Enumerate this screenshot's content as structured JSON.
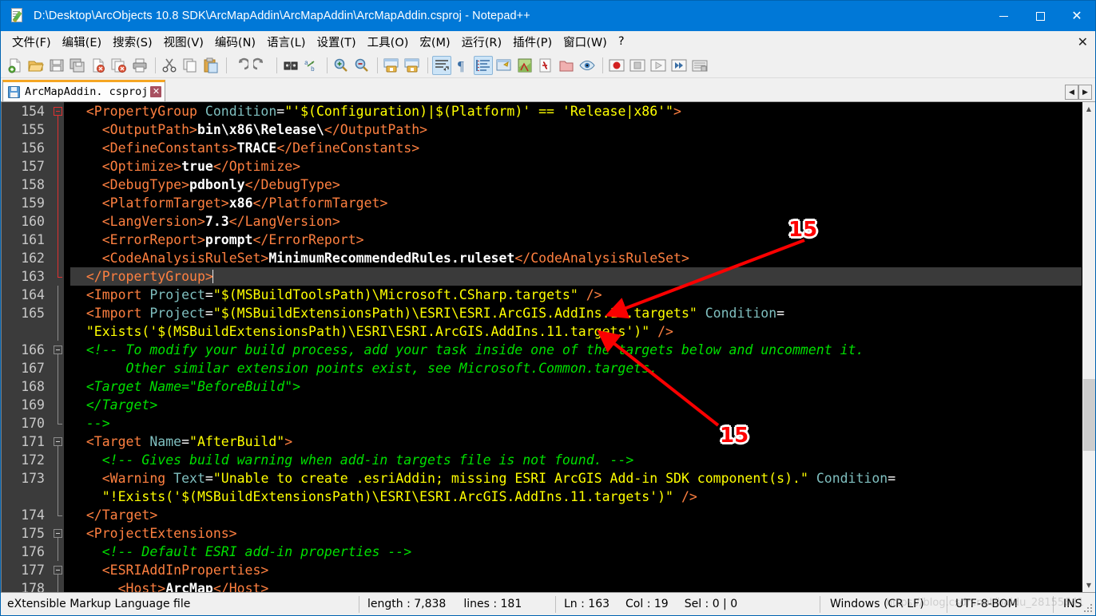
{
  "window": {
    "title": "D:\\Desktop\\ArcObjects 10.8 SDK\\ArcMapAddin\\ArcMapAddin\\ArcMapAddin.csproj - Notepad++",
    "app_icon": "notepad-plus-plus-icon",
    "minimize_label": "–",
    "maximize_label": "",
    "close_label": "✕",
    "titlebar_color": "#0078d7"
  },
  "menu": {
    "items": [
      {
        "label": "文件(F)",
        "name": "menu-file"
      },
      {
        "label": "编辑(E)",
        "name": "menu-edit"
      },
      {
        "label": "搜索(S)",
        "name": "menu-search"
      },
      {
        "label": "视图(V)",
        "name": "menu-view"
      },
      {
        "label": "编码(N)",
        "name": "menu-encoding"
      },
      {
        "label": "语言(L)",
        "name": "menu-language"
      },
      {
        "label": "设置(T)",
        "name": "menu-settings"
      },
      {
        "label": "工具(O)",
        "name": "menu-tools"
      },
      {
        "label": "宏(M)",
        "name": "menu-macro"
      },
      {
        "label": "运行(R)",
        "name": "menu-run"
      },
      {
        "label": "插件(P)",
        "name": "menu-plugins"
      },
      {
        "label": "窗口(W)",
        "name": "menu-window"
      },
      {
        "label": "?",
        "name": "menu-help"
      }
    ],
    "close_doc_label": "✕"
  },
  "toolbar": {
    "buttons": [
      {
        "name": "new-file-icon",
        "title": "New"
      },
      {
        "name": "open-file-icon",
        "title": "Open"
      },
      {
        "name": "save-icon",
        "title": "Save"
      },
      {
        "name": "save-all-icon",
        "title": "Save All"
      },
      {
        "name": "close-file-icon",
        "title": "Close"
      },
      {
        "name": "close-all-icon",
        "title": "Close All"
      },
      {
        "name": "print-icon",
        "title": "Print"
      },
      {
        "name": "sep",
        "title": ""
      },
      {
        "name": "cut-icon",
        "title": "Cut"
      },
      {
        "name": "copy-icon",
        "title": "Copy"
      },
      {
        "name": "paste-icon",
        "title": "Paste"
      },
      {
        "name": "sep",
        "title": ""
      },
      {
        "name": "undo-icon",
        "title": "Undo"
      },
      {
        "name": "redo-icon",
        "title": "Redo"
      },
      {
        "name": "sep",
        "title": ""
      },
      {
        "name": "find-icon",
        "title": "Find"
      },
      {
        "name": "replace-icon",
        "title": "Replace"
      },
      {
        "name": "sep",
        "title": ""
      },
      {
        "name": "zoom-in-icon",
        "title": "Zoom In"
      },
      {
        "name": "zoom-out-icon",
        "title": "Zoom Out"
      },
      {
        "name": "sep",
        "title": ""
      },
      {
        "name": "sync-vertical-icon",
        "title": "Sync Vertical Scrolling"
      },
      {
        "name": "sync-horizontal-icon",
        "title": "Sync Horizontal Scrolling"
      },
      {
        "name": "sep",
        "title": ""
      },
      {
        "name": "word-wrap-icon",
        "title": "Word wrap"
      },
      {
        "name": "show-all-chars-icon",
        "title": "Show All Characters"
      },
      {
        "name": "indent-guide-icon",
        "title": "Show Indent Guide"
      },
      {
        "name": "user-defined-dialog-icon",
        "title": "User Defined Dialogue"
      },
      {
        "name": "doc-map-icon",
        "title": "Document Map"
      },
      {
        "name": "function-list-icon",
        "title": "Function List"
      },
      {
        "name": "folder-workspace-icon",
        "title": "Folder as Workspace"
      },
      {
        "name": "monitoring-icon",
        "title": "Monitoring"
      },
      {
        "name": "sep",
        "title": ""
      },
      {
        "name": "macro-record-icon",
        "title": "Start Recording"
      },
      {
        "name": "macro-stop-icon",
        "title": "Stop Recording"
      },
      {
        "name": "macro-play-icon",
        "title": "Playback"
      },
      {
        "name": "macro-run-multi-icon",
        "title": "Run a Macro Multiple Times"
      },
      {
        "name": "macro-save-icon",
        "title": "Save Current Recorded Macro"
      }
    ]
  },
  "tabs": {
    "active_index": 0,
    "items": [
      {
        "label": "ArcMapAddin. csproj",
        "icon": "saved-disk-icon",
        "close_label": "✕"
      }
    ],
    "scroll_left_label": "◀",
    "scroll_right_label": "▶"
  },
  "editor": {
    "first_line": 154,
    "current_line": 163,
    "lines": [
      {
        "num": "154",
        "fold": "open-active",
        "tokens": [
          {
            "t": "  ",
            "c": "t-gray"
          },
          {
            "t": "<PropertyGroup",
            "c": "t-tag"
          },
          {
            "t": " Condition",
            "c": "t-attr"
          },
          {
            "t": "=",
            "c": "t-eq"
          },
          {
            "t": "\"'$(Configuration)|$(Platform)' == 'Release|x86'\"",
            "c": "t-str"
          },
          {
            "t": ">",
            "c": "t-tag"
          }
        ]
      },
      {
        "num": "155",
        "fold": "bar-active",
        "tokens": [
          {
            "t": "    ",
            "c": "t-gray"
          },
          {
            "t": "<OutputPath>",
            "c": "t-tag"
          },
          {
            "t": "bin\\x86\\Release\\",
            "c": "t-val"
          },
          {
            "t": "</OutputPath>",
            "c": "t-tag"
          }
        ]
      },
      {
        "num": "156",
        "fold": "bar-active",
        "tokens": [
          {
            "t": "    ",
            "c": "t-gray"
          },
          {
            "t": "<DefineConstants>",
            "c": "t-tag"
          },
          {
            "t": "TRACE",
            "c": "t-val"
          },
          {
            "t": "</DefineConstants>",
            "c": "t-tag"
          }
        ]
      },
      {
        "num": "157",
        "fold": "bar-active",
        "tokens": [
          {
            "t": "    ",
            "c": "t-gray"
          },
          {
            "t": "<Optimize>",
            "c": "t-tag"
          },
          {
            "t": "true",
            "c": "t-val"
          },
          {
            "t": "</Optimize>",
            "c": "t-tag"
          }
        ]
      },
      {
        "num": "158",
        "fold": "bar-active",
        "tokens": [
          {
            "t": "    ",
            "c": "t-gray"
          },
          {
            "t": "<DebugType>",
            "c": "t-tag"
          },
          {
            "t": "pdbonly",
            "c": "t-val"
          },
          {
            "t": "</DebugType>",
            "c": "t-tag"
          }
        ]
      },
      {
        "num": "159",
        "fold": "bar-active",
        "tokens": [
          {
            "t": "    ",
            "c": "t-gray"
          },
          {
            "t": "<PlatformTarget>",
            "c": "t-tag"
          },
          {
            "t": "x86",
            "c": "t-val"
          },
          {
            "t": "</PlatformTarget>",
            "c": "t-tag"
          }
        ]
      },
      {
        "num": "160",
        "fold": "bar-active",
        "tokens": [
          {
            "t": "    ",
            "c": "t-gray"
          },
          {
            "t": "<LangVersion>",
            "c": "t-tag"
          },
          {
            "t": "7.3",
            "c": "t-val"
          },
          {
            "t": "</LangVersion>",
            "c": "t-tag"
          }
        ]
      },
      {
        "num": "161",
        "fold": "bar-active",
        "tokens": [
          {
            "t": "    ",
            "c": "t-gray"
          },
          {
            "t": "<ErrorReport>",
            "c": "t-tag"
          },
          {
            "t": "prompt",
            "c": "t-val"
          },
          {
            "t": "</ErrorReport>",
            "c": "t-tag"
          }
        ]
      },
      {
        "num": "162",
        "fold": "bar-active",
        "tokens": [
          {
            "t": "    ",
            "c": "t-gray"
          },
          {
            "t": "<CodeAnalysisRuleSet>",
            "c": "t-tag"
          },
          {
            "t": "MinimumRecommendedRules.ruleset",
            "c": "t-val"
          },
          {
            "t": "</CodeAnalysisRuleSet>",
            "c": "t-tag"
          }
        ]
      },
      {
        "num": "163",
        "fold": "end-active",
        "current": true,
        "tokens": [
          {
            "t": "  ",
            "c": "t-gray"
          },
          {
            "t": "</PropertyGroup>",
            "c": "t-tag"
          },
          {
            "t": "\u0000caret",
            "c": "caret"
          }
        ]
      },
      {
        "num": "164",
        "fold": "bar",
        "tokens": [
          {
            "t": "  ",
            "c": "t-gray"
          },
          {
            "t": "<Import",
            "c": "t-tag"
          },
          {
            "t": " Project",
            "c": "t-attr"
          },
          {
            "t": "=",
            "c": "t-eq"
          },
          {
            "t": "\"$(MSBuildToolsPath)\\Microsoft.CSharp.targets\"",
            "c": "t-str"
          },
          {
            "t": " ",
            "c": "t-gray"
          },
          {
            "t": "/>",
            "c": "t-tag"
          }
        ]
      },
      {
        "num": "165",
        "fold": "bar",
        "tokens": [
          {
            "t": "  ",
            "c": "t-gray"
          },
          {
            "t": "<Import",
            "c": "t-tag"
          },
          {
            "t": " Project",
            "c": "t-attr"
          },
          {
            "t": "=",
            "c": "t-eq"
          },
          {
            "t": "\"$(MSBuildExtensionsPath)\\ESRI\\ESRI.ArcGIS.AddIns.11.targets\"",
            "c": "t-str"
          },
          {
            "t": " Condition",
            "c": "t-attr"
          },
          {
            "t": "=",
            "c": "t-eq"
          }
        ]
      },
      {
        "num": "",
        "fold": "bar",
        "wrap": true,
        "tokens": [
          {
            "t": "  ",
            "c": "t-gray"
          },
          {
            "t": "\"Exists('$(MSBuildExtensionsPath)\\ESRI\\ESRI.ArcGIS.AddIns.11.targets')\"",
            "c": "t-str"
          },
          {
            "t": " ",
            "c": "t-gray"
          },
          {
            "t": "/>",
            "c": "t-tag"
          }
        ]
      },
      {
        "num": "166",
        "fold": "open",
        "tokens": [
          {
            "t": "  ",
            "c": "t-gray"
          },
          {
            "t": "<!-- To modify your build process, add your task inside one of the targets below and uncomment it.",
            "c": "t-com"
          }
        ]
      },
      {
        "num": "167",
        "fold": "dotted",
        "tokens": [
          {
            "t": "       Other similar extension points exist, see Microsoft.Common.targets.",
            "c": "t-com"
          }
        ]
      },
      {
        "num": "168",
        "fold": "dotted",
        "tokens": [
          {
            "t": "  ",
            "c": "t-gray"
          },
          {
            "t": "<Target Name=\"BeforeBuild\">",
            "c": "t-com"
          }
        ]
      },
      {
        "num": "169",
        "fold": "dotted",
        "tokens": [
          {
            "t": "  ",
            "c": "t-gray"
          },
          {
            "t": "</Target>",
            "c": "t-com"
          }
        ]
      },
      {
        "num": "170",
        "fold": "end",
        "tokens": [
          {
            "t": "  ",
            "c": "t-gray"
          },
          {
            "t": "-->",
            "c": "t-com"
          }
        ]
      },
      {
        "num": "171",
        "fold": "open",
        "tokens": [
          {
            "t": "  ",
            "c": "t-gray"
          },
          {
            "t": "<Target",
            "c": "t-tag"
          },
          {
            "t": " Name",
            "c": "t-attr"
          },
          {
            "t": "=",
            "c": "t-eq"
          },
          {
            "t": "\"AfterBuild\"",
            "c": "t-str"
          },
          {
            "t": ">",
            "c": "t-tag"
          }
        ]
      },
      {
        "num": "172",
        "fold": "bar",
        "tokens": [
          {
            "t": "    ",
            "c": "t-gray"
          },
          {
            "t": "<!-- Gives build warning when add-in targets file is not found. -->",
            "c": "t-com"
          }
        ]
      },
      {
        "num": "173",
        "fold": "bar",
        "tokens": [
          {
            "t": "    ",
            "c": "t-gray"
          },
          {
            "t": "<Warning",
            "c": "t-tag"
          },
          {
            "t": " Text",
            "c": "t-attr"
          },
          {
            "t": "=",
            "c": "t-eq"
          },
          {
            "t": "\"Unable to create .esriAddin; missing ESRI ArcGIS Add-in SDK component(s).\"",
            "c": "t-str"
          },
          {
            "t": " Condition",
            "c": "t-attr"
          },
          {
            "t": "=",
            "c": "t-eq"
          }
        ]
      },
      {
        "num": "",
        "fold": "bar",
        "wrap": true,
        "tokens": [
          {
            "t": "    ",
            "c": "t-gray"
          },
          {
            "t": "\"!Exists('$(MSBuildExtensionsPath)\\ESRI\\ESRI.ArcGIS.AddIns.11.targets')\"",
            "c": "t-str"
          },
          {
            "t": " ",
            "c": "t-gray"
          },
          {
            "t": "/>",
            "c": "t-tag"
          }
        ]
      },
      {
        "num": "174",
        "fold": "end",
        "tokens": [
          {
            "t": "  ",
            "c": "t-gray"
          },
          {
            "t": "</Target>",
            "c": "t-tag"
          }
        ]
      },
      {
        "num": "175",
        "fold": "open",
        "tokens": [
          {
            "t": "  ",
            "c": "t-gray"
          },
          {
            "t": "<ProjectExtensions>",
            "c": "t-tag"
          }
        ]
      },
      {
        "num": "176",
        "fold": "bar",
        "tokens": [
          {
            "t": "    ",
            "c": "t-gray"
          },
          {
            "t": "<!-- Default ESRI add-in properties -->",
            "c": "t-com"
          }
        ]
      },
      {
        "num": "177",
        "fold": "open",
        "tokens": [
          {
            "t": "    ",
            "c": "t-gray"
          },
          {
            "t": "<ESRIAddInProperties>",
            "c": "t-tag"
          }
        ]
      },
      {
        "num": "178",
        "fold": "bar",
        "clipped": true,
        "tokens": [
          {
            "t": "      ",
            "c": "t-gray"
          },
          {
            "t": "<Host>",
            "c": "t-tag"
          },
          {
            "t": "ArcMap",
            "c": "t-val"
          },
          {
            "t": "</Host>",
            "c": "t-tag"
          }
        ]
      }
    ],
    "colors": {
      "background": "#000000",
      "tag": "#ff8040",
      "attribute": "#7fbfbf",
      "string": "#ffff00",
      "value": "#ffffff",
      "comment": "#00e000",
      "gutter_bg": "#3b3b3b",
      "gutter_fg": "#c8c8c8",
      "current_line_bg": "#3a3a3a",
      "fold_active": "#e03030"
    }
  },
  "scrollbar": {
    "up_label": "▲",
    "down_label": "▼"
  },
  "statusbar": {
    "doc_type": "eXtensible Markup Language file",
    "length_label": "length : 7,838",
    "lines_label": "lines : 181",
    "ln_label": "Ln : 163",
    "col_label": "Col : 19",
    "sel_label": "Sel : 0 | 0",
    "eol": "Windows (CR LF)",
    "encoding": "UTF-8-BOM",
    "insert_mode": "INS",
    "watermark": "https://blog.csdn.net/baidu_28155641"
  },
  "annotations": [
    {
      "label": "15",
      "name": "annotation-marker-1"
    },
    {
      "label": "15",
      "name": "annotation-marker-2"
    }
  ]
}
